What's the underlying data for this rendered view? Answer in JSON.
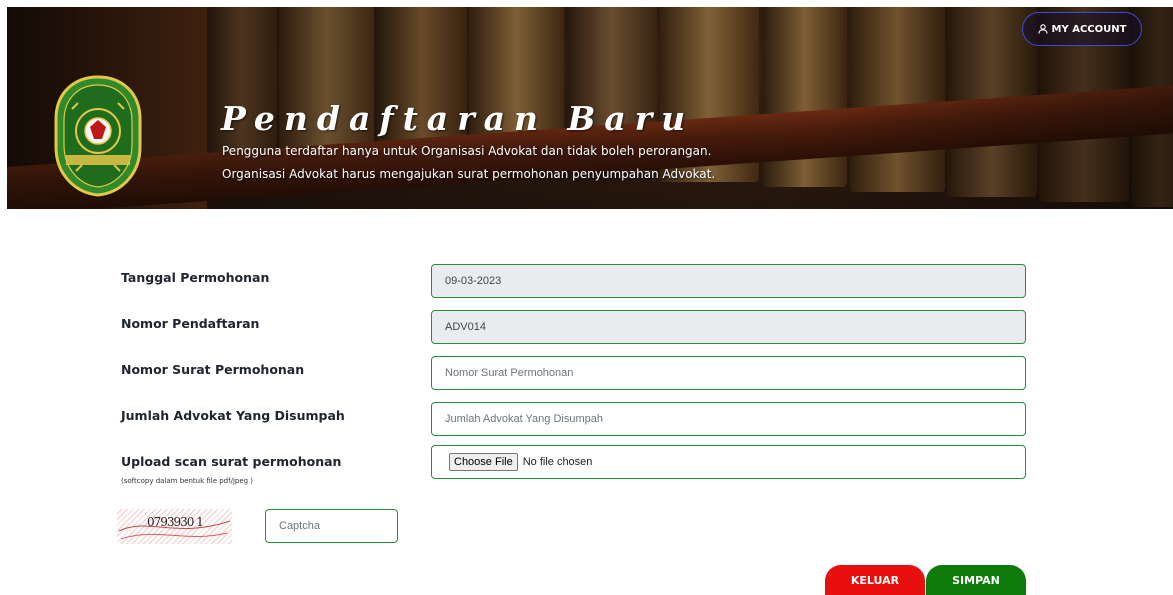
{
  "header": {
    "title": "Pendaftaran Baru",
    "subtitle_line1": "Pengguna terdaftar hanya untuk Organisasi Advokat dan tidak boleh perorangan.",
    "subtitle_line2": "Organisasi Advokat harus mengajukan surat permohonan penyumpahan Advokat.",
    "account_button": "MY ACCOUNT",
    "logo_text": "PENGADILAN TINGGI RIAU",
    "account_icon": "user-icon"
  },
  "form": {
    "tanggal": {
      "label": "Tanggal Permohonan",
      "value": "09-03-2023"
    },
    "nomor_pendaftaran": {
      "label": "Nomor Pendaftaran",
      "value": "ADV014"
    },
    "nomor_surat": {
      "label": "Nomor Surat Permohonan",
      "placeholder": "Nomor Surat Permohonan"
    },
    "jumlah_advokat": {
      "label": "Jumlah Advokat Yang Disumpah",
      "placeholder": "Jumlah Advokat Yang Disumpah"
    },
    "upload": {
      "label": "Upload scan surat permohonan",
      "hint": "(softcopy dalam bentuk file pdf/jpeg )",
      "button": "Choose File",
      "status": "No file chosen"
    },
    "captcha": {
      "code": "0793930 1",
      "placeholder": "Captcha"
    }
  },
  "actions": {
    "keluar": "KELUAR",
    "simpan": "SIMPAN"
  },
  "colors": {
    "border_green": "#2e8b3a",
    "keluar_red": "#e8100f",
    "simpan_green": "#0e7a0a",
    "account_border": "#3b4bd6"
  }
}
